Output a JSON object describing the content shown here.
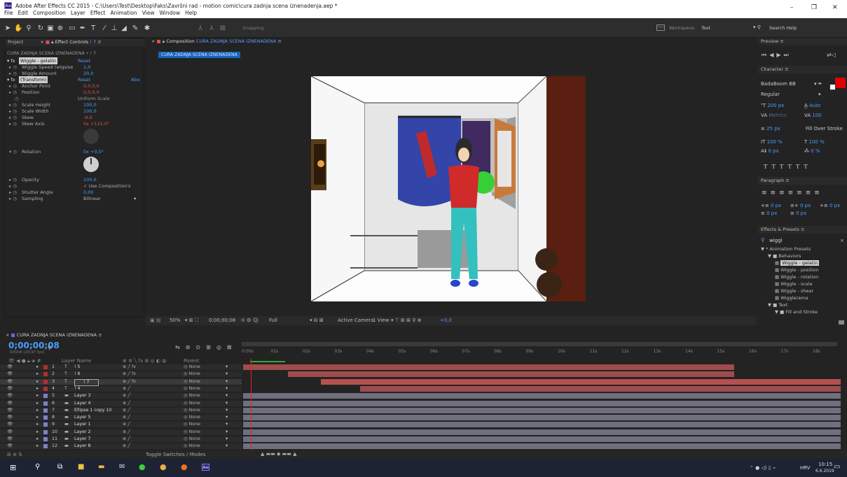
{
  "window": {
    "title": "Adobe After Effects CC 2015 - C:\\Users\\Test\\Desktop\\Faks\\Završni rad - motion comic\\cura zadnja scena iznenadenja.aep *",
    "controls": [
      "–",
      "❐",
      "✕"
    ]
  },
  "menu": [
    "File",
    "Edit",
    "Composition",
    "Layer",
    "Effect",
    "Animation",
    "View",
    "Window",
    "Help"
  ],
  "toolbar": {
    "snapping": "Snapping",
    "workspace_label": "Workspace:",
    "workspace_value": "Text",
    "search": "Search Help"
  },
  "effect_controls": {
    "tab_project": "Project",
    "tab_ec": "Effect Controls",
    "tab_ec_layer": "! 7",
    "header": "CURA ZADNJA SCENA IZNENADENA • ! 7",
    "rows": [
      {
        "t": "fx",
        "label": "Wiggle - gelatin",
        "val": "Reset"
      },
      {
        "t": "p",
        "label": "Wiggle Speed (wigs/se",
        "val": "1,0"
      },
      {
        "t": "p",
        "label": "Wiggle Amount",
        "val": "20,0"
      },
      {
        "t": "fx",
        "label": "(Transform)",
        "val": "Reset",
        "extra": "Abo"
      },
      {
        "t": "p",
        "label": "Anchor Point",
        "val": "0,0,0,0",
        "red": true
      },
      {
        "t": "p",
        "label": "Position",
        "val": "0,0,0,0",
        "red": true
      },
      {
        "t": "c",
        "label": "",
        "val": "Uniform Scale"
      },
      {
        "t": "p",
        "label": "Scale Height",
        "val": "100,0"
      },
      {
        "t": "p",
        "label": "Scale Width",
        "val": "100,0"
      },
      {
        "t": "p",
        "label": "Skew",
        "val": "-9,6",
        "red": true
      },
      {
        "t": "p",
        "label": "Skew Axis",
        "val": "0x +121,0°",
        "red": true
      }
    ],
    "rotation": {
      "label": "Rotation",
      "val": "0x +0,0°"
    },
    "rows2": [
      {
        "label": "Opacity",
        "val": "100,0"
      },
      {
        "label": "",
        "val": "✓ Use Composition's"
      },
      {
        "label": "Shutter Angle",
        "val": "0,00"
      },
      {
        "label": "Sampling",
        "val": "Bilinear"
      }
    ]
  },
  "composition": {
    "tab": "Composition",
    "tab_name": "CURA ZADNJA SCENA IZNENADENA",
    "tag": "CURA ZADNJA SCENA IZNENADENA",
    "footer": {
      "zoom": "50%",
      "time": "0;00;00;08",
      "res": "Full",
      "camera": "Active Camera",
      "view": "1 View",
      "exposure": "+0,0"
    }
  },
  "right": {
    "preview": "Preview",
    "character": "Character",
    "font": "BadaBoom BB",
    "style": "Regular",
    "size": "200 px",
    "leading": "Auto",
    "kerning": "Metrics",
    "tracking": "100",
    "stroke": "25 px",
    "stroke_type": "Fill Over Stroke",
    "vscale": "100 %",
    "hscale": "100 %",
    "baseline": "0 px",
    "tsume": "0 %",
    "paragraph": "Paragraph",
    "indent": [
      "0 px",
      "0 px",
      "0 px",
      "0 px",
      "0 px"
    ],
    "effects": "Effects & Presets",
    "query": "wiggl",
    "tree": [
      {
        "d": 0,
        "t": "▼ * Animation Presets"
      },
      {
        "d": 1,
        "t": "▼ ■ Behaviors"
      },
      {
        "d": 2,
        "t": "Wiggle - gelatin",
        "sel": true
      },
      {
        "d": 2,
        "t": "Wiggle - position"
      },
      {
        "d": 2,
        "t": "Wiggle - rotation"
      },
      {
        "d": 2,
        "t": "Wiggle - scale"
      },
      {
        "d": 2,
        "t": "Wiggle - shear"
      },
      {
        "d": 2,
        "t": "Wigglerama"
      },
      {
        "d": 1,
        "t": "▼ ■ Text"
      },
      {
        "d": 2,
        "t": "▼ ■ Fill and Stroke"
      }
    ]
  },
  "timeline": {
    "tab": "CURA ZADNJA SCENA IZNENADENA",
    "timecode": "0;00;00;08",
    "fps": "00008 (29,97 fps)",
    "col_layer": "Layer Name",
    "col_parent": "Parent",
    "toggle": "Toggle Switches / Modes",
    "ruler": [
      "0:00s",
      "01s",
      "02s",
      "03s",
      "04s",
      "05s",
      "06s",
      "07s",
      "08s",
      "09s",
      "10s",
      "11s",
      "12s",
      "13s",
      "14s",
      "15s",
      "16s",
      "17s",
      "18s"
    ],
    "layers": [
      {
        "n": "1",
        "name": "! 5",
        "color": "#b03030",
        "parent": "None",
        "start": 0.0,
        "end": 0.82,
        "bar": "rd"
      },
      {
        "n": "2",
        "name": "! 6",
        "color": "#b03030",
        "parent": "None",
        "start": 0.075,
        "end": 0.82,
        "bar": "rd"
      },
      {
        "n": "3",
        "name": "! 7",
        "color": "#b03030",
        "parent": "None",
        "start": 0.13,
        "end": 1.0,
        "bar": "rd",
        "sel": true
      },
      {
        "n": "4",
        "name": "! 4",
        "color": "#b03030",
        "parent": "None",
        "start": 0.195,
        "end": 1.0,
        "bar": "rd"
      },
      {
        "n": "5",
        "name": "Layer 3",
        "color": "#8080c8",
        "parent": "None",
        "start": 0.0,
        "end": 1.0,
        "bar": "gr"
      },
      {
        "n": "6",
        "name": "Layer 4",
        "color": "#8080c8",
        "parent": "None",
        "start": 0.0,
        "end": 1.0,
        "bar": "gr"
      },
      {
        "n": "7",
        "name": "Ellipse 1 copy 10",
        "color": "#8080c8",
        "parent": "None",
        "start": 0.0,
        "end": 1.0,
        "bar": "gr"
      },
      {
        "n": "8",
        "name": "Layer 5",
        "color": "#8080c8",
        "parent": "None",
        "start": 0.0,
        "end": 1.0,
        "bar": "gr"
      },
      {
        "n": "9",
        "name": "Layer 1",
        "color": "#8080c8",
        "parent": "None",
        "start": 0.0,
        "end": 1.0,
        "bar": "gr"
      },
      {
        "n": "10",
        "name": "Layer 2",
        "color": "#8080c8",
        "parent": "None",
        "start": 0.0,
        "end": 1.0,
        "bar": "gr"
      },
      {
        "n": "11",
        "name": "Layer 7",
        "color": "#8080c8",
        "parent": "None",
        "start": 0.0,
        "end": 1.0,
        "bar": "gr"
      },
      {
        "n": "12",
        "name": "Layer 8",
        "color": "#8080c8",
        "parent": "None",
        "start": 0.0,
        "end": 1.0,
        "bar": "gr"
      }
    ]
  },
  "taskbar": {
    "time": "10:15",
    "date": "6.6.2019",
    "lang": "HRV"
  }
}
